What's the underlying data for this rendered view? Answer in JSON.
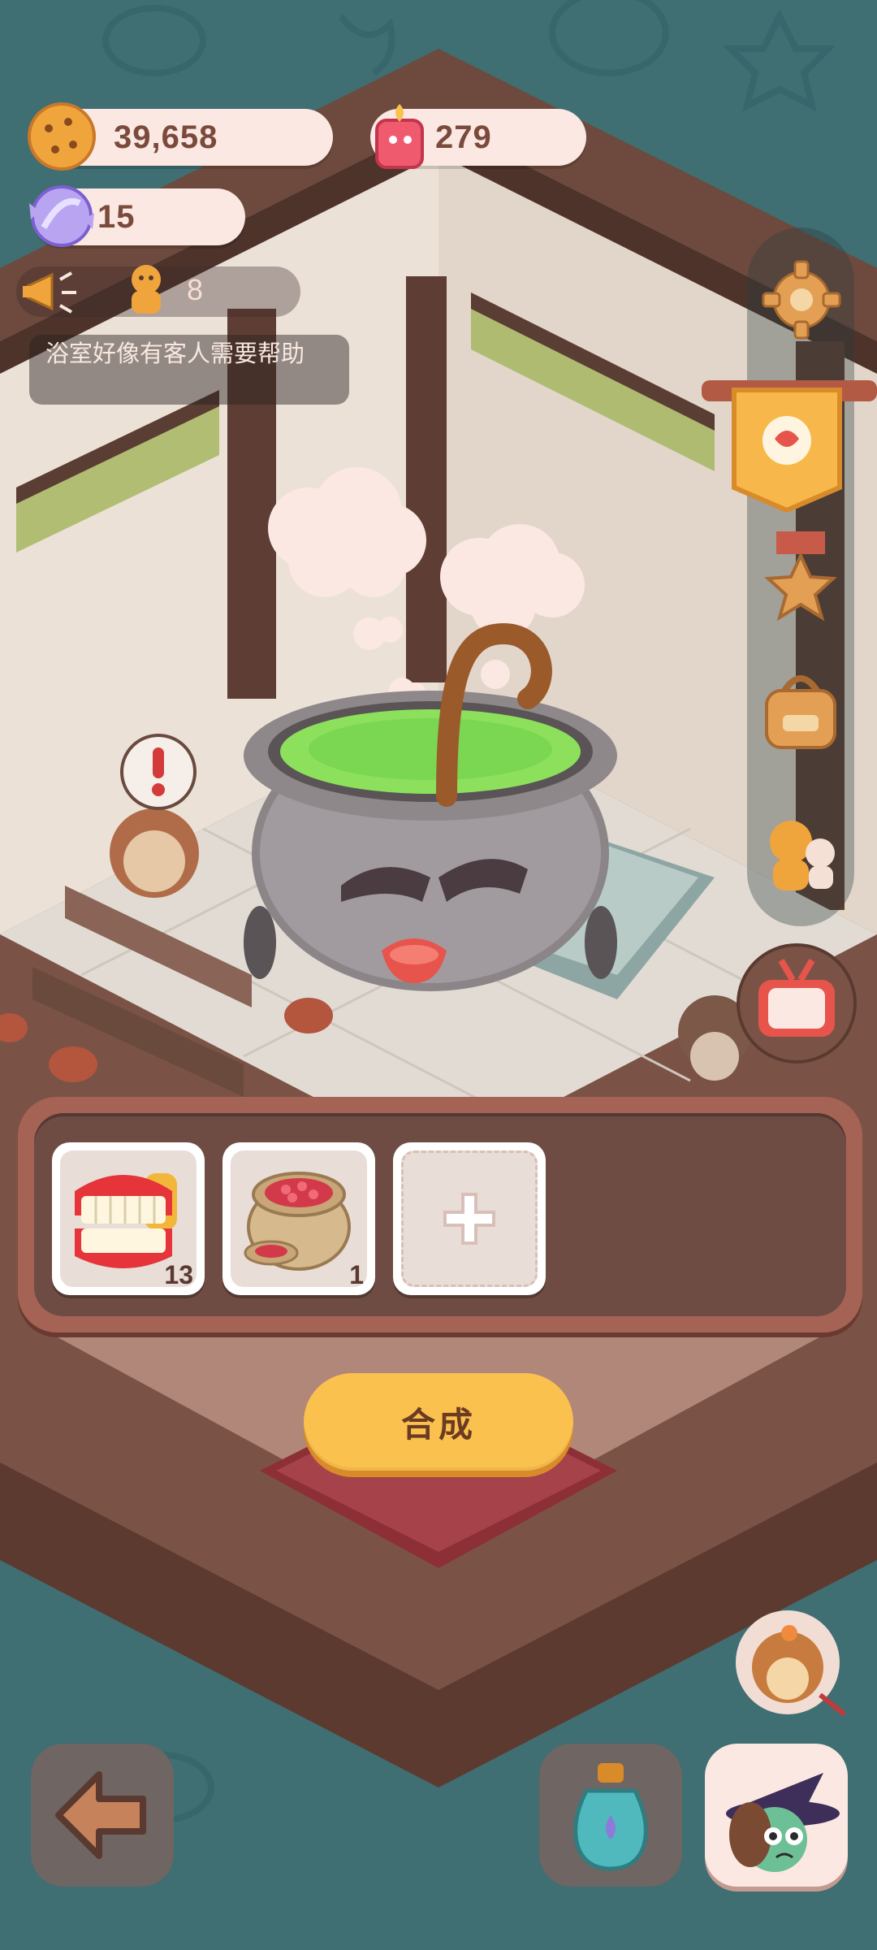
{
  "currency": {
    "cookies": "39,658",
    "candles": "279",
    "candy": "15"
  },
  "ad": {
    "count": "8"
  },
  "notice": "浴室好像有客人需要帮助",
  "craft": {
    "slots": [
      {
        "item": "false-teeth",
        "qty": "13"
      },
      {
        "item": "bean-sack",
        "qty": "1"
      },
      {
        "item": "empty",
        "qty": ""
      }
    ],
    "button_label": "合成"
  },
  "icons": {
    "cookie": "cookie-icon",
    "candle": "candle-icon",
    "candy": "candy-icon",
    "megaphone": "megaphone-icon",
    "settings": "gear-icon",
    "shop": "shop-banner-icon",
    "medal": "medal-icon",
    "bag": "backpack-icon",
    "friends": "friends-icon",
    "tv": "tv-icon",
    "back": "back-arrow-icon",
    "potion": "potion-icon",
    "witch": "witch-avatar-icon"
  }
}
